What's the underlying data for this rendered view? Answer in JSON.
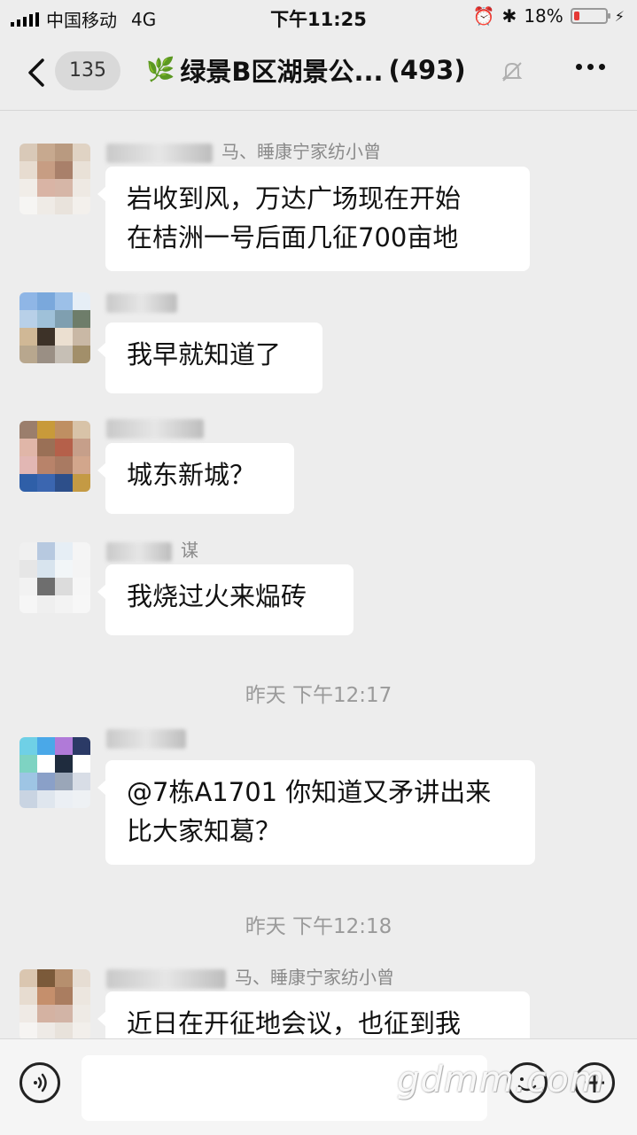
{
  "status_bar": {
    "carrier": "中国移动",
    "network": "4G",
    "time": "下午11:25",
    "battery": "18%",
    "battery_level": 0.18
  },
  "header": {
    "unread_count": "135",
    "title": "绿景B区湖景公...",
    "member_count": "(493)"
  },
  "messages": [
    {
      "sender": "马、睡康宁家纺小曾",
      "text_lines": [
        "岩收到风，万达广场现在开始",
        "在桔洲一号后面几征700亩地"
      ]
    },
    {
      "sender": "",
      "text_lines": [
        "我早就知道了"
      ]
    },
    {
      "sender": "",
      "text_lines": [
        "城东新城？"
      ]
    },
    {
      "sender": "谋",
      "text_lines": [
        "我烧过火来煰砖"
      ]
    },
    {
      "sender": "",
      "text_lines": [
        "@7栋A1701 你知道又矛讲出来",
        "比大家知葛？"
      ]
    },
    {
      "sender": "马、睡康宁家纺小曾",
      "text_lines": [
        "近日在开征地会议，也征到我"
      ]
    }
  ],
  "timestamps": [
    "昨天  下午12:17",
    "昨天  下午12:18"
  ],
  "input_bar": {
    "value": "",
    "watermark": "gdmm.com"
  }
}
